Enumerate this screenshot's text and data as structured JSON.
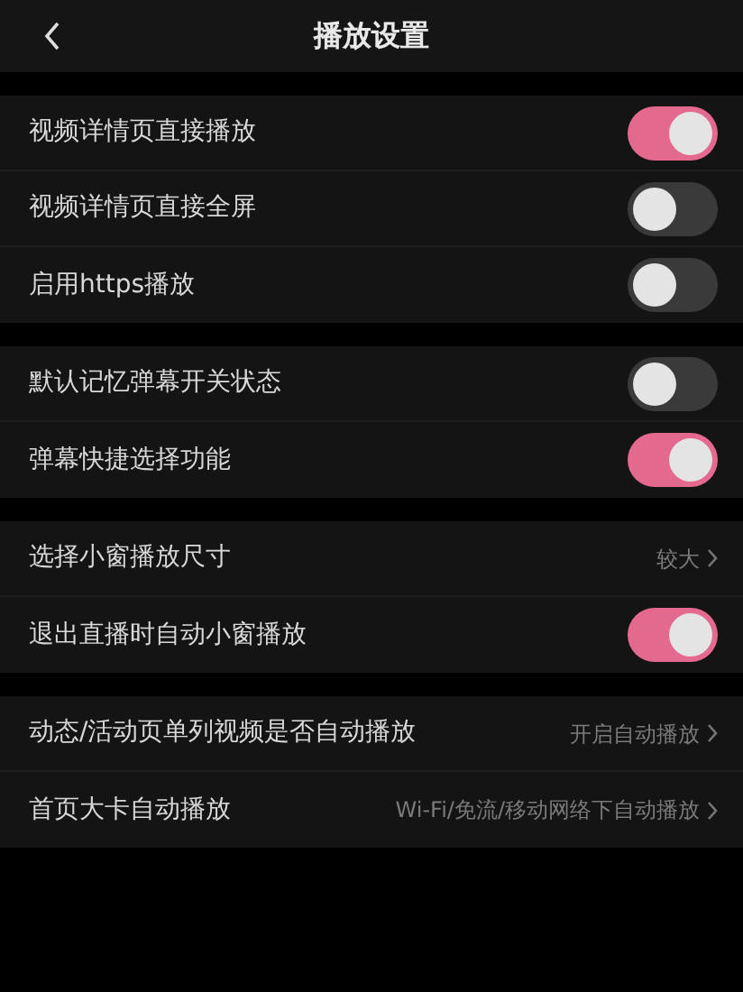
{
  "header": {
    "title": "播放设置"
  },
  "groups": [
    {
      "items": [
        {
          "kind": "toggle",
          "label": "视频详情页直接播放",
          "on": true
        },
        {
          "kind": "toggle",
          "label": "视频详情页直接全屏",
          "on": false
        },
        {
          "kind": "toggle",
          "label": "启用https播放",
          "on": false
        }
      ]
    },
    {
      "items": [
        {
          "kind": "toggle",
          "label": "默认记忆弹幕开关状态",
          "on": false
        },
        {
          "kind": "toggle",
          "label": "弹幕快捷选择功能",
          "on": true
        }
      ]
    },
    {
      "items": [
        {
          "kind": "link",
          "label": "选择小窗播放尺寸",
          "value": "较大"
        },
        {
          "kind": "toggle",
          "label": "退出直播时自动小窗播放",
          "on": true
        }
      ]
    },
    {
      "items": [
        {
          "kind": "link",
          "label": "动态/活动页单列视频是否自动播放",
          "value": "开启自动播放"
        },
        {
          "kind": "link",
          "label": "首页大卡自动播放",
          "value": "Wi-Fi/免流/移动网络下自动播放"
        }
      ]
    }
  ]
}
